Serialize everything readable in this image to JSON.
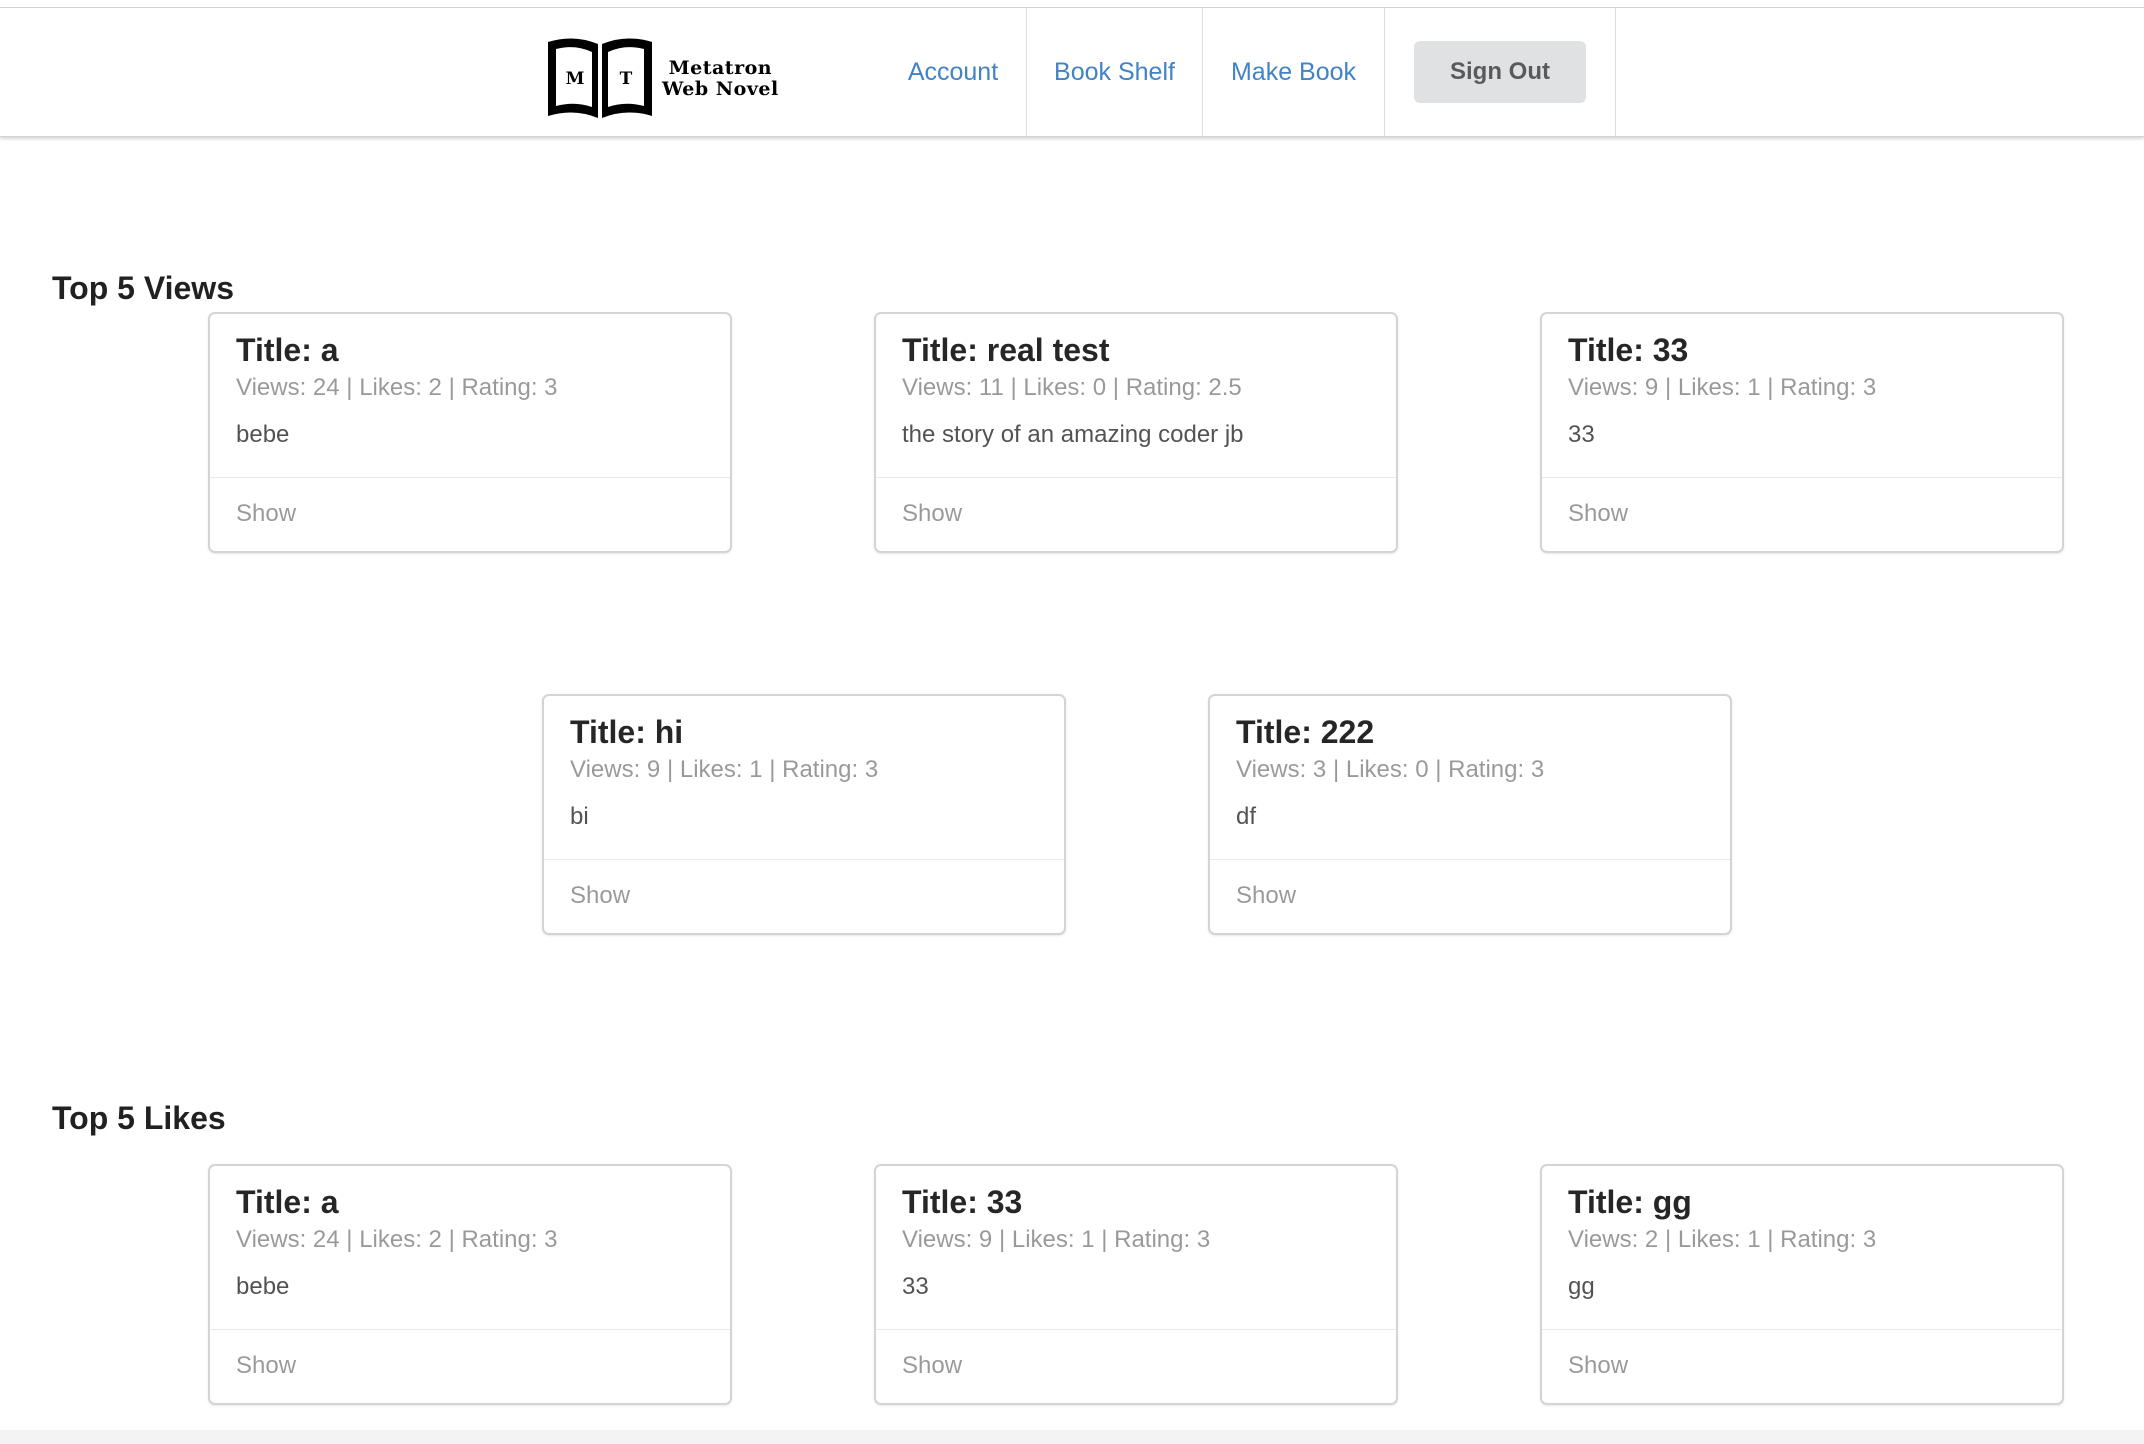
{
  "brand": {
    "logo_lines": [
      "Metatron",
      "Web Novel"
    ],
    "logo_letters": [
      "M",
      "T"
    ]
  },
  "nav": {
    "account": "Account",
    "book_shelf": "Book Shelf",
    "make_book": "Make Book",
    "sign_out": "Sign Out"
  },
  "sections": [
    {
      "title": "Top 5 Views",
      "cards": [
        {
          "title": "Title: a",
          "meta": "Views: 24 | Likes: 2 | Rating: 3",
          "description": "bebe",
          "action": "Show"
        },
        {
          "title": "Title: real test",
          "meta": "Views: 11 | Likes: 0 | Rating: 2.5",
          "description": "the story of an amazing coder jb",
          "action": "Show"
        },
        {
          "title": "Title: 33",
          "meta": "Views: 9 | Likes: 1 | Rating: 3",
          "description": "33",
          "action": "Show"
        },
        {
          "title": "Title: hi",
          "meta": "Views: 9 | Likes: 1 | Rating: 3",
          "description": "bi",
          "action": "Show"
        },
        {
          "title": "Title: 222",
          "meta": "Views: 3 | Likes: 0 | Rating: 3",
          "description": "df",
          "action": "Show"
        }
      ]
    },
    {
      "title": "Top 5 Likes",
      "cards": [
        {
          "title": "Title: a",
          "meta": "Views: 24 | Likes: 2 | Rating: 3",
          "description": "bebe",
          "action": "Show"
        },
        {
          "title": "Title: 33",
          "meta": "Views: 9 | Likes: 1 | Rating: 3",
          "description": "33",
          "action": "Show"
        },
        {
          "title": "Title: gg",
          "meta": "Views: 2 | Likes: 1 | Rating: 3",
          "description": "gg",
          "action": "Show"
        }
      ]
    }
  ],
  "colors": {
    "link": "#4183c4",
    "button_bg": "#e0e1e2",
    "border": "#d4d4d5"
  }
}
